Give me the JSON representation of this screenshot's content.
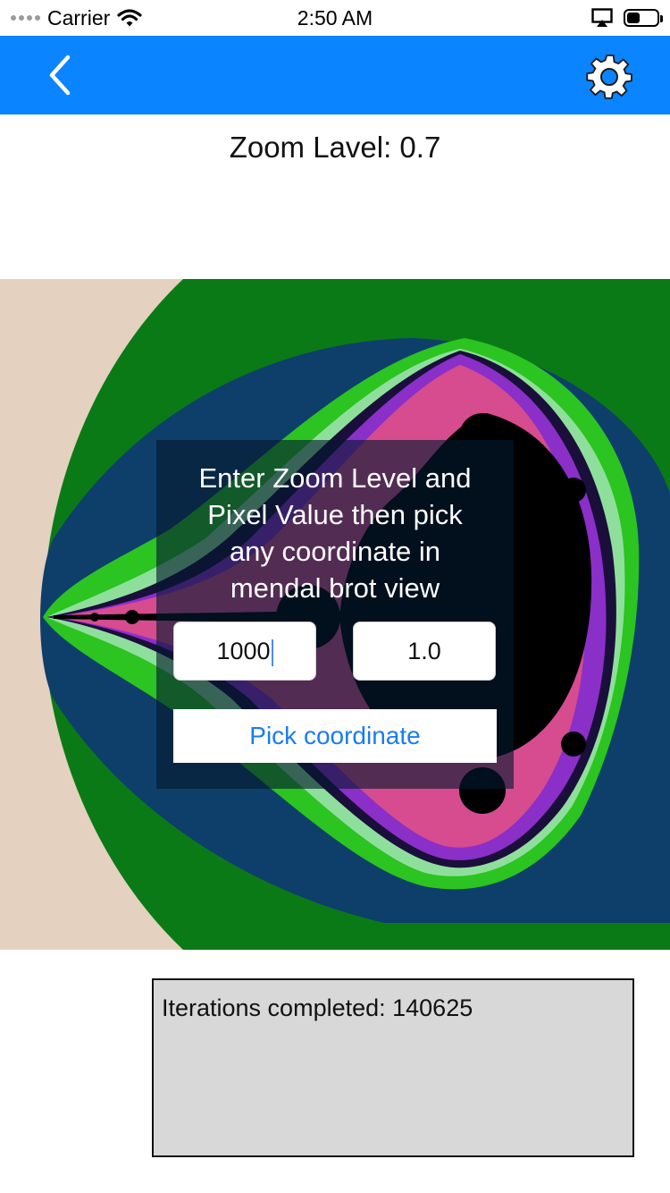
{
  "status_bar": {
    "carrier": "Carrier",
    "time": "2:50 AM",
    "icons": [
      "signal-dots-icon",
      "wifi-icon",
      "airplay-icon",
      "battery-icon"
    ]
  },
  "nav_bar": {
    "background": "#0a84ff",
    "back_icon": "chevron-left-icon",
    "settings_icon": "gear-icon"
  },
  "zoom_label": "Zoom Lavel: 0.7",
  "overlay": {
    "instructions": "Enter Zoom Level and\nPixel Value then pick\nany coordinate in\nmendal brot view",
    "zoom_field_value": "1000",
    "pixel_field_value": "1.0",
    "pick_button_label": "Pick coordinate"
  },
  "fractal": {
    "palette": {
      "background": "#e4d1c0",
      "ring1": "#0a7a16",
      "ring2": "#0e3f6b",
      "ring3": "#2bc421",
      "ring4": "#8fdf9c",
      "ring5": "#1a0f3a",
      "ring6": "#8b2fc9",
      "set": "#000000"
    }
  },
  "iterations": {
    "text": "Iterations completed: 140625"
  }
}
